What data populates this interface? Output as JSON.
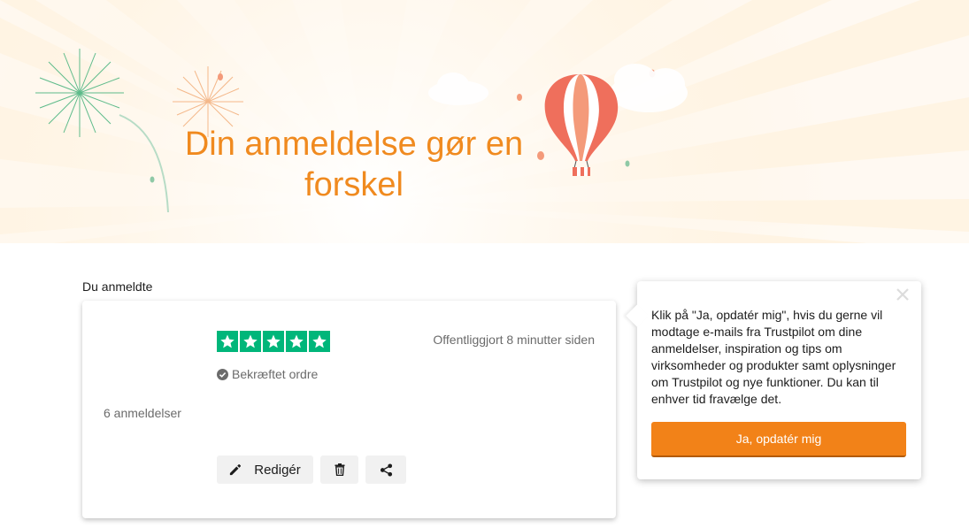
{
  "hero": {
    "title_line1": "Din anmeldelse gør en",
    "title_line2": "forskel"
  },
  "review_section": {
    "label": "Du anmeldte",
    "rating": 5,
    "published": "Offentliggjort 8 minutter siden",
    "verified_label": "Bekræftet ordre",
    "review_count": "6 anmeldelser",
    "actions": {
      "edit_label": "Redigér",
      "delete_icon": "trash-icon",
      "share_icon": "share-icon"
    }
  },
  "popover": {
    "text": "Klik på \"Ja, opdatér mig\", hvis du gerne vil modtage e-mails fra Trustpilot om dine anmeldelser, inspiration og tips om virksomheder og produkter samt oplysninger om Trustpilot og nye funktioner. Du kan til enhver tid fravælge det.",
    "button_label": "Ja, opdatér mig",
    "close_icon": "close-icon"
  },
  "colors": {
    "accent_orange": "#f28218",
    "title_orange": "#f08a1f",
    "trustpilot_green": "#00b67a"
  }
}
